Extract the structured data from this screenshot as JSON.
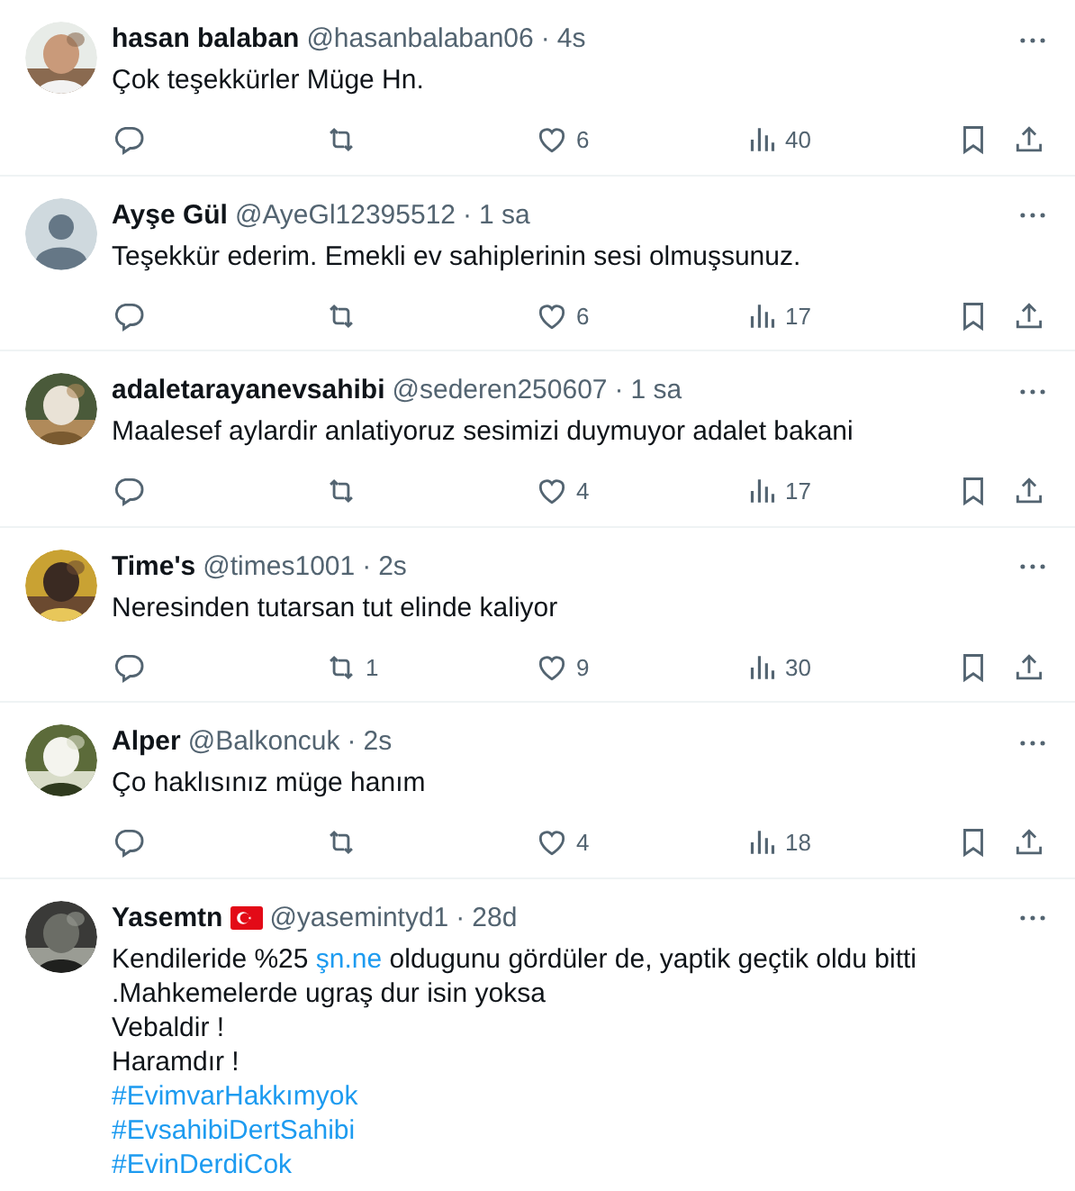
{
  "replies": [
    {
      "name": "hasan balaban",
      "flag": false,
      "handle": "@hasanbalaban06",
      "separator": "·",
      "time": "4s",
      "body": [
        [
          {
            "kind": "text",
            "text": "Çok teşekkürler Müge Hn."
          }
        ]
      ],
      "actions": {
        "likes": "6",
        "views": "40"
      }
    },
    {
      "avatar": {
        "kind": "default"
      },
      "name": "Ayşe Gül",
      "flag": false,
      "handle": "@AyeGl12395512",
      "separator": "·",
      "time": "1 sa",
      "body": [
        [
          {
            "kind": "text",
            "text": "Teşekkür ederim. Emekli ev sahiplerinin sesi olmuşsunuz."
          }
        ]
      ],
      "actions": {
        "likes": "6",
        "views": "17"
      }
    },
    {
      "name": "adaletarayanevsahibi",
      "flag": false,
      "handle": "@sederen250607",
      "separator": "·",
      "time": "1 sa",
      "body": [
        [
          {
            "kind": "text",
            "text": "Maalesef aylardir anlatiyoruz sesimizi duymuyor adalet bakani"
          }
        ]
      ],
      "actions": {
        "likes": "4",
        "views": "17"
      }
    },
    {
      "name": "Time's",
      "flag": false,
      "handle": "@times1001",
      "separator": "·",
      "time": "2s",
      "body": [
        [
          {
            "kind": "text",
            "text": "Neresinden tutarsan tut elinde kaliyor"
          }
        ]
      ],
      "actions": {
        "retweets": "1",
        "likes": "9",
        "views": "30"
      }
    },
    {
      "name": "Alper",
      "flag": false,
      "handle": "@Balkoncuk",
      "separator": "·",
      "time": "2s",
      "body": [
        [
          {
            "kind": "text",
            "text": "Ço haklısınız müge hanım"
          }
        ]
      ],
      "actions": {
        "likes": "4",
        "views": "18"
      }
    },
    {
      "name": "Yasemtn",
      "flag": true,
      "handle": "@yasemintyd1",
      "separator": "·",
      "time": "28d",
      "body": [
        [
          {
            "kind": "text",
            "text": "Kendileride %25 "
          },
          {
            "kind": "link",
            "text": "şn.ne"
          },
          {
            "kind": "text",
            "text": " oldugunu gördüler de, yaptik geçtik oldu bitti .Mahkemelerde ugraş dur isin yoksa"
          }
        ],
        [
          {
            "kind": "text",
            "text": "Vebaldir !"
          }
        ],
        [
          {
            "kind": "text",
            "text": "Haramdır !"
          }
        ],
        [
          {
            "kind": "link",
            "text": "#EvimvarHakkımyok"
          }
        ],
        [
          {
            "kind": "link",
            "text": "#EvsahibiDertSahibi"
          }
        ],
        [
          {
            "kind": "link",
            "text": "#EvinDerdiCok"
          }
        ]
      ]
    }
  ]
}
